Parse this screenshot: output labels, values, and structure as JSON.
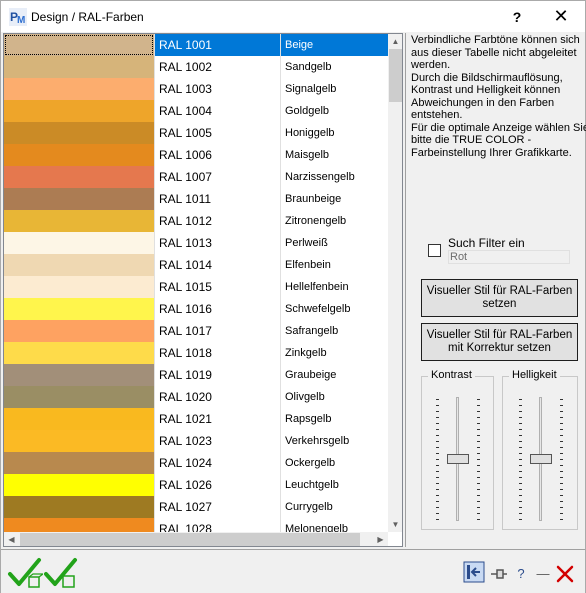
{
  "window": {
    "title": "Design / RAL-Farben",
    "help_label": "?",
    "close_label": "✕"
  },
  "colors": {
    "selection": "#0078d7",
    "accent_green": "#22a31a",
    "close_red": "#d20000"
  },
  "ral_list": {
    "rows": [
      {
        "code": "RAL 1001",
        "name": "Beige",
        "color": "#d1b48c",
        "selected": true
      },
      {
        "code": "RAL 1002",
        "name": "Sandgelb",
        "color": "#d6b47a"
      },
      {
        "code": "RAL 1003",
        "name": "Signalgelb",
        "color": "#fcad6e"
      },
      {
        "code": "RAL 1004",
        "name": "Goldgelb",
        "color": "#eea52a"
      },
      {
        "code": "RAL 1005",
        "name": "Honiggelb",
        "color": "#cb8b26"
      },
      {
        "code": "RAL 1006",
        "name": "Maisgelb",
        "color": "#e48a1e"
      },
      {
        "code": "RAL 1007",
        "name": "Narzissengelb",
        "color": "#e5784e"
      },
      {
        "code": "RAL 1011",
        "name": "Braunbeige",
        "color": "#ac7c53"
      },
      {
        "code": "RAL 1012",
        "name": "Zitronengelb",
        "color": "#e8b636"
      },
      {
        "code": "RAL 1013",
        "name": "Perlweiß",
        "color": "#fdf6e6"
      },
      {
        "code": "RAL 1014",
        "name": "Elfenbein",
        "color": "#efd8b2"
      },
      {
        "code": "RAL 1015",
        "name": "Hellelfenbein",
        "color": "#fcebd1"
      },
      {
        "code": "RAL 1016",
        "name": "Schwefelgelb",
        "color": "#fff54c"
      },
      {
        "code": "RAL 1017",
        "name": "Safrangelb",
        "color": "#fea261"
      },
      {
        "code": "RAL 1018",
        "name": "Zinkgelb",
        "color": "#fedb4a"
      },
      {
        "code": "RAL 1019",
        "name": "Graubeige",
        "color": "#a28f79"
      },
      {
        "code": "RAL 1020",
        "name": "Olivgelb",
        "color": "#9a8e64"
      },
      {
        "code": "RAL 1021",
        "name": "Rapsgelb",
        "color": "#f9b91f"
      },
      {
        "code": "RAL 1023",
        "name": "Verkehrsgelb",
        "color": "#fbba24"
      },
      {
        "code": "RAL 1024",
        "name": "Ockergelb",
        "color": "#b8894e"
      },
      {
        "code": "RAL 1026",
        "name": "Leuchtgelb",
        "color": "#ffff01"
      },
      {
        "code": "RAL 1027",
        "name": "Currygelb",
        "color": "#9e7a22"
      },
      {
        "code": "RAL 1028",
        "name": "Melonengelb",
        "color": "#ef8a1f"
      }
    ]
  },
  "info_text": {
    "lines": [
      "Verbindliche Farbtöne können sich",
      "aus dieser Tabelle nicht abgeleitet",
      "werden.",
      "Durch die Bildschirmauflösung,",
      "Kontrast und Helligkeit können",
      "Abweichungen in den Farben",
      "entstehen.",
      "Für die optimale Anzeige wählen Sie",
      "bitte die TRUE COLOR -",
      "Farbeinstellung Ihrer Grafikkarte."
    ]
  },
  "filter": {
    "checkbox_label": "Such Filter ein",
    "value": "Rot",
    "checked": false
  },
  "buttons": {
    "style_label": "Visueller Stil für RAL-Farben setzen",
    "style_correction_label": "Visueller Stil für RAL-Farben mit Korrektur setzen"
  },
  "sliders": {
    "contrast_label": "Kontrast",
    "brightness_label": "Helligkeit",
    "contrast_level": 0.5,
    "brightness_level": 0.5
  },
  "bottom_toolbar": {
    "ok_icon": "check-icon",
    "ok_apply_icon": "check-apply-icon",
    "tool_icons": [
      "panel-toggle-icon",
      "pin-icon",
      "help-icon",
      "minimize-icon",
      "close-icon"
    ],
    "help_label": "?",
    "minimize_label": "—"
  }
}
